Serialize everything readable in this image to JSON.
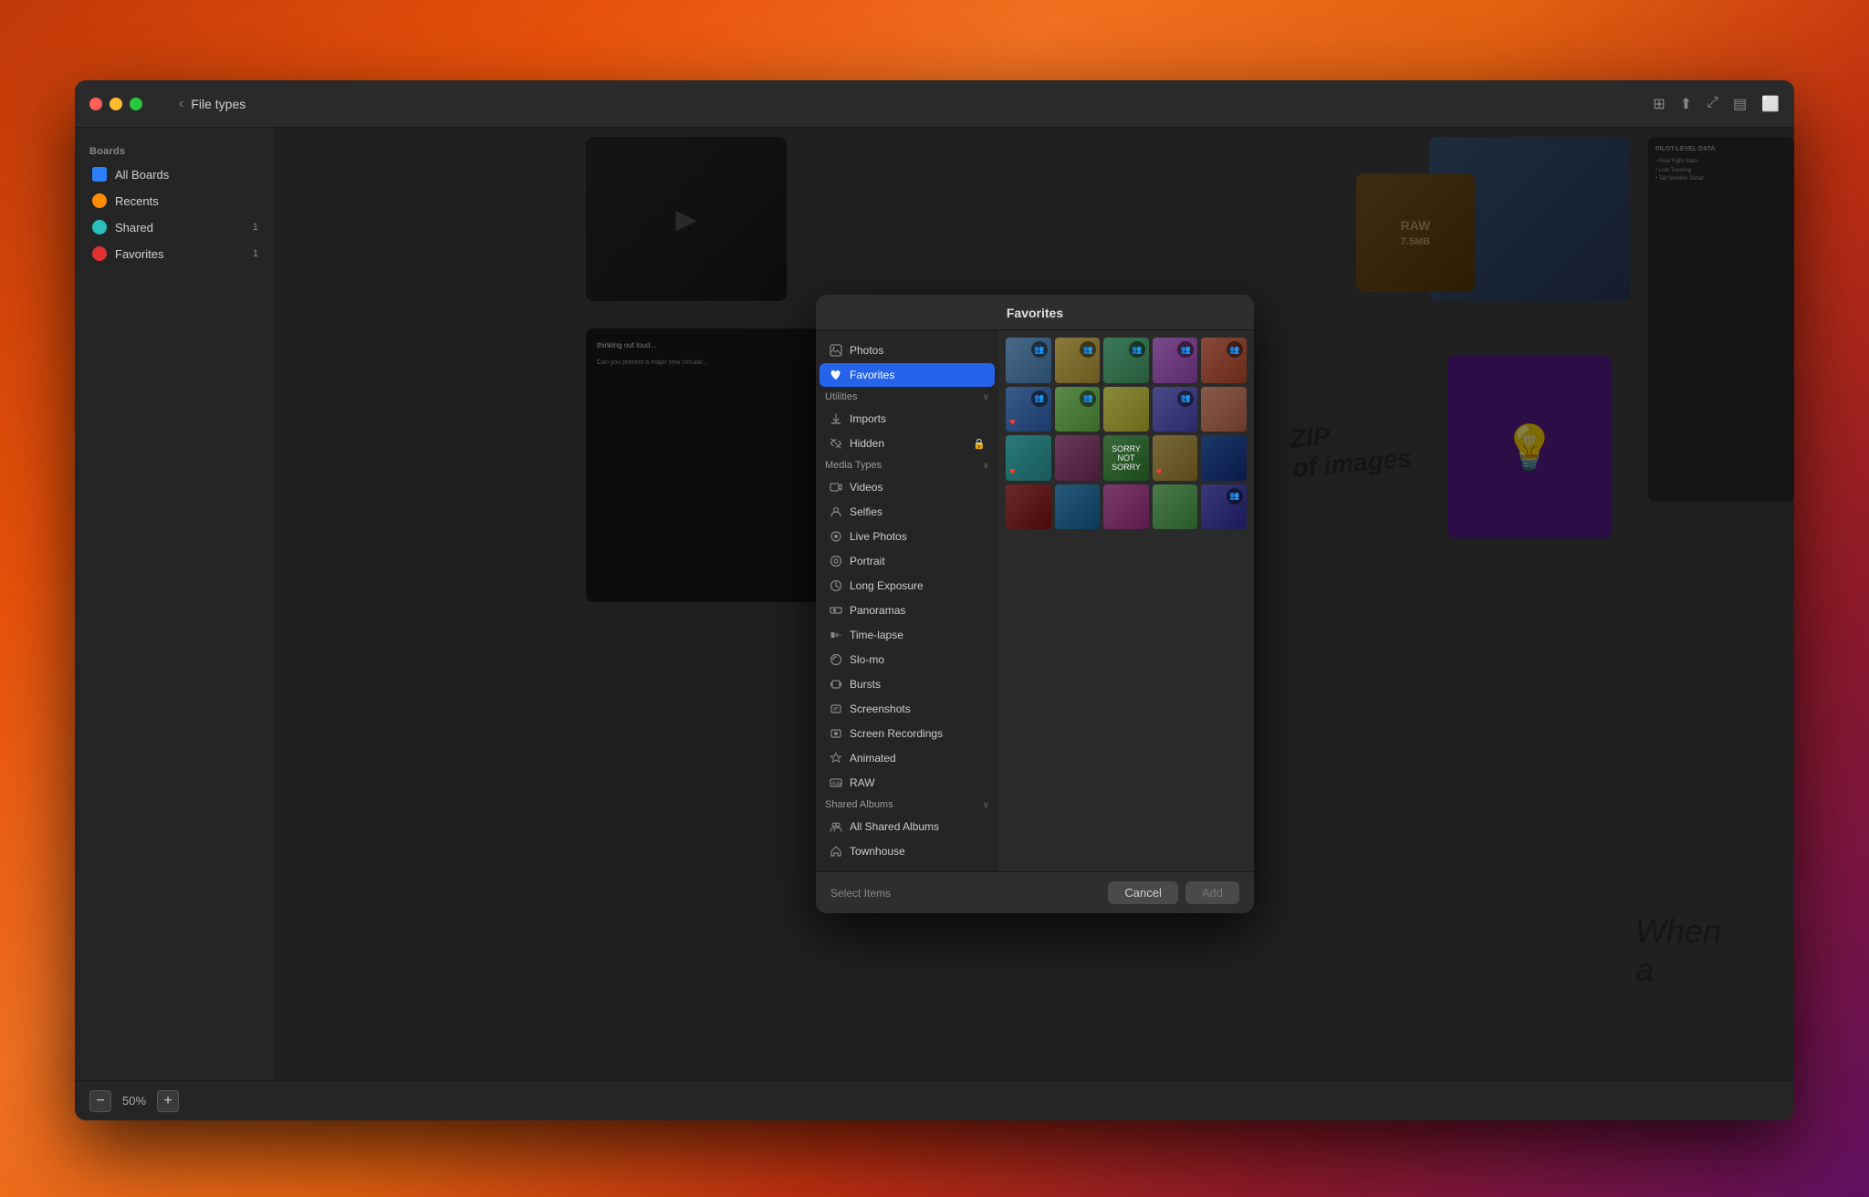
{
  "window": {
    "title": "File types",
    "zoom": "50%"
  },
  "sidebar": {
    "section_boards": "Boards",
    "items": [
      {
        "id": "all-boards",
        "label": "All Boards",
        "icon": "grid",
        "active": false,
        "count": ""
      },
      {
        "id": "recents",
        "label": "Recents",
        "icon": "clock",
        "active": false,
        "count": ""
      },
      {
        "id": "shared",
        "label": "Shared",
        "icon": "person-2",
        "active": false,
        "count": "1"
      },
      {
        "id": "favorites",
        "label": "Favorites",
        "icon": "star",
        "active": false,
        "count": "1"
      }
    ]
  },
  "dialog": {
    "title": "Favorites",
    "sidebar": {
      "items": [
        {
          "id": "photos",
          "label": "Photos",
          "icon": "photo",
          "active": false
        },
        {
          "id": "favorites",
          "label": "Favorites",
          "icon": "heart",
          "active": true
        }
      ],
      "utilities_label": "Utilities",
      "utilities": [
        {
          "id": "imports",
          "label": "Imports",
          "icon": "arrow-down",
          "active": false
        },
        {
          "id": "hidden",
          "label": "Hidden",
          "icon": "eye-slash",
          "active": false,
          "lock": true
        }
      ],
      "media_types_label": "Media Types",
      "media_types": [
        {
          "id": "videos",
          "label": "Videos",
          "icon": "film"
        },
        {
          "id": "selfies",
          "label": "Selfies",
          "icon": "person"
        },
        {
          "id": "live-photos",
          "label": "Live Photos",
          "icon": "circle-dot"
        },
        {
          "id": "portrait",
          "label": "Portrait",
          "icon": "aperture"
        },
        {
          "id": "long-exposure",
          "label": "Long Exposure",
          "icon": "timer"
        },
        {
          "id": "panoramas",
          "label": "Panoramas",
          "icon": "panorama"
        },
        {
          "id": "time-lapse",
          "label": "Time-lapse",
          "icon": "clock-fast"
        },
        {
          "id": "slo-mo",
          "label": "Slo-mo",
          "icon": "snail"
        },
        {
          "id": "bursts",
          "label": "Bursts",
          "icon": "burst"
        },
        {
          "id": "screenshots",
          "label": "Screenshots",
          "icon": "screenshot"
        },
        {
          "id": "screen-recordings",
          "label": "Screen Recordings",
          "icon": "record"
        },
        {
          "id": "animated",
          "label": "Animated",
          "icon": "sparkles"
        },
        {
          "id": "raw",
          "label": "RAW",
          "icon": "raw"
        }
      ],
      "shared_albums_label": "Shared Albums",
      "shared_albums": [
        {
          "id": "all-shared-albums",
          "label": "All Shared Albums",
          "icon": "person-2"
        },
        {
          "id": "townhouse",
          "label": "Townhouse",
          "icon": "house"
        }
      ]
    },
    "footer": {
      "select_label": "Select Items",
      "cancel_label": "Cancel",
      "add_label": "Add"
    },
    "photos": [
      {
        "id": 1,
        "color": "pc-1",
        "has_people": true,
        "has_heart": false
      },
      {
        "id": 2,
        "color": "pc-2",
        "has_people": true,
        "has_heart": false
      },
      {
        "id": 3,
        "color": "pc-3",
        "has_people": true,
        "has_heart": false
      },
      {
        "id": 4,
        "color": "pc-4",
        "has_people": true,
        "has_heart": false
      },
      {
        "id": 5,
        "color": "pc-5",
        "has_people": true,
        "has_heart": false
      },
      {
        "id": 6,
        "color": "pc-6",
        "has_people": true,
        "has_heart": true
      },
      {
        "id": 7,
        "color": "pc-7",
        "has_people": true,
        "has_heart": false
      },
      {
        "id": 8,
        "color": "pc-8",
        "has_people": false,
        "has_heart": false
      },
      {
        "id": 9,
        "color": "pc-9",
        "has_people": true,
        "has_heart": false
      },
      {
        "id": 10,
        "color": "pc-10",
        "has_people": false,
        "has_heart": false
      },
      {
        "id": 11,
        "color": "pc-11",
        "has_people": false,
        "has_heart": true
      },
      {
        "id": 12,
        "color": "pc-12",
        "has_people": false,
        "has_heart": false
      },
      {
        "id": 13,
        "color": "pc-13",
        "has_people": false,
        "has_heart": false
      },
      {
        "id": 14,
        "color": "pc-14",
        "has_people": false,
        "has_heart": true
      },
      {
        "id": 15,
        "color": "pc-15",
        "has_people": false,
        "has_heart": false
      },
      {
        "id": 16,
        "color": "pc-16",
        "has_people": false,
        "has_heart": false
      },
      {
        "id": 17,
        "color": "pc-17",
        "has_people": false,
        "has_heart": false
      },
      {
        "id": 18,
        "color": "pc-18",
        "has_people": false,
        "has_heart": false
      },
      {
        "id": 19,
        "color": "pc-19",
        "has_people": false,
        "has_heart": false
      },
      {
        "id": 20,
        "color": "pc-20",
        "has_people": true,
        "has_heart": false
      }
    ]
  },
  "zoom": {
    "level": "50%",
    "minus_label": "−",
    "plus_label": "+"
  },
  "icons": {
    "back_arrow": "‹",
    "heart": "♥",
    "people": "👥",
    "lock": "🔒"
  }
}
